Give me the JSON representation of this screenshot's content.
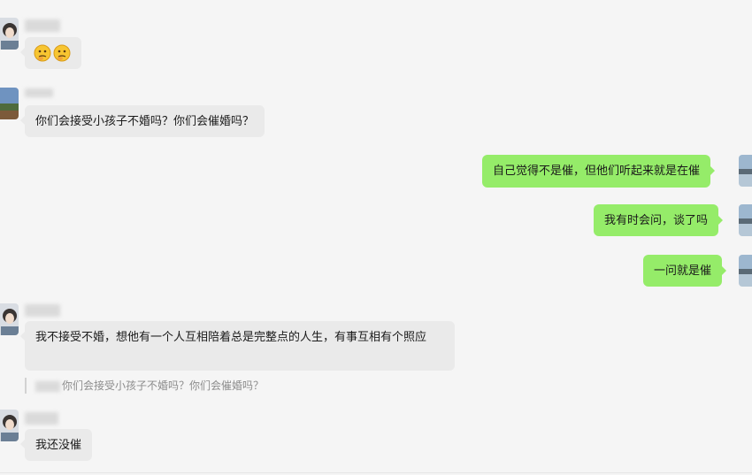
{
  "messages": [
    {
      "id": "m1",
      "direction": "incoming",
      "emoji": [
        "thinking-face-emoji",
        "thinking-face-emoji"
      ]
    },
    {
      "id": "m2",
      "direction": "incoming",
      "text": "你们会接受小孩子不婚吗？你们会催婚吗？"
    },
    {
      "id": "m3",
      "direction": "outgoing",
      "text": "自己觉得不是催，但他们听起来就是在催"
    },
    {
      "id": "m4",
      "direction": "outgoing",
      "text": "我有时会问，谈了吗"
    },
    {
      "id": "m5",
      "direction": "outgoing",
      "text": "一问就是催"
    },
    {
      "id": "m6",
      "direction": "incoming",
      "text": "我不接受不婚，想他有一个人互相陪着总是完整点的人生，有事互相有个照应"
    },
    {
      "id": "m7",
      "direction": "incoming",
      "text": "我还没催"
    }
  ],
  "quote": {
    "text": "你们会接受小孩子不婚吗？你们会催婚吗？"
  },
  "colors": {
    "background": "#f5f5f5",
    "incoming_bubble": "#eaeaea",
    "outgoing_bubble": "#95ec69",
    "quote_text": "#8c8c8c"
  }
}
